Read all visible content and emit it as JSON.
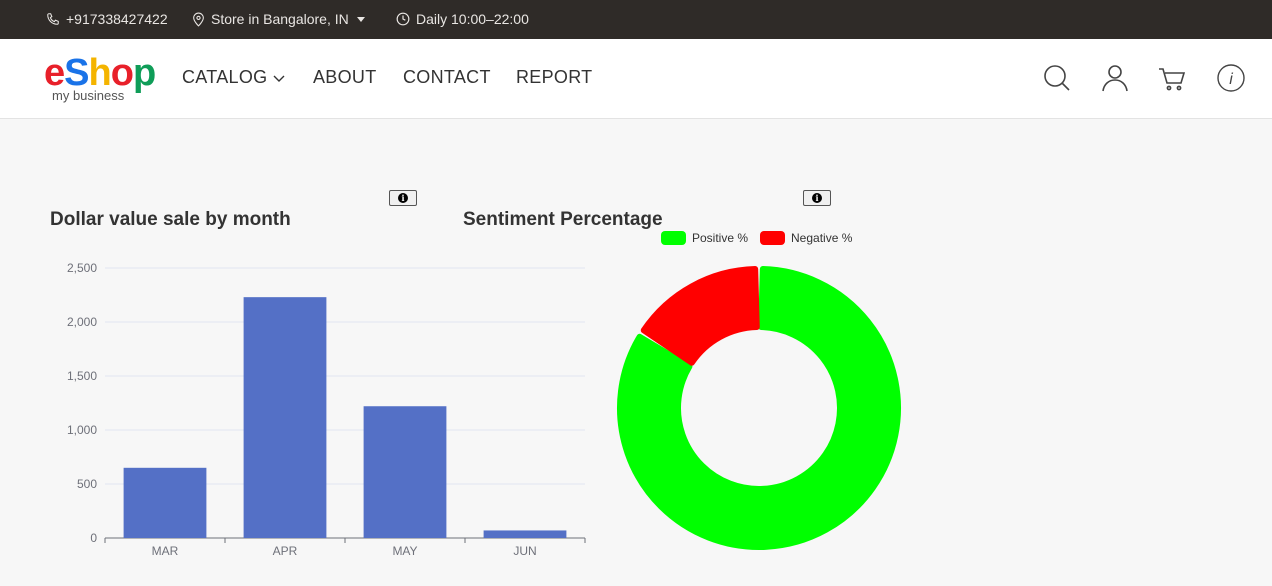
{
  "topbar": {
    "phone": "+917338427422",
    "store": "Store in Bangalore, IN",
    "hours": "Daily 10:00–22:00"
  },
  "header": {
    "logo": {
      "letters": [
        "e",
        "S",
        "h",
        "o",
        "p"
      ],
      "subtitle": "my business"
    },
    "nav": {
      "catalog": "CATALOG",
      "about": "ABOUT",
      "contact": "CONTACT",
      "report": "REPORT"
    },
    "icons": [
      "search-icon",
      "user-icon",
      "cart-icon",
      "info-icon"
    ]
  },
  "colors": {
    "topbar_bg": "#2f2b28",
    "bar": "#5470c6",
    "positive": "#00ff00",
    "negative": "#ff0000",
    "logo": [
      "#e8202a",
      "#1a73e8",
      "#f4b400",
      "#e8202a",
      "#0f9d58"
    ]
  },
  "charts": {
    "sales_title": "Dollar value sale by month",
    "sentiment_title": "Sentiment Percentage",
    "legend": {
      "positive": "Positive %",
      "negative": "Negative %"
    }
  },
  "chart_data": [
    {
      "type": "bar",
      "title": "Dollar value sale by month",
      "categories": [
        "MAR",
        "APR",
        "MAY",
        "JUN"
      ],
      "values": [
        650,
        2230,
        1220,
        70
      ],
      "yticks": [
        "0",
        "500",
        "1,000",
        "1,500",
        "2,000",
        "2,500"
      ],
      "ylim": [
        0,
        2500
      ],
      "grid": true
    },
    {
      "type": "pie",
      "title": "Sentiment Percentage",
      "donut": true,
      "series": [
        {
          "name": "Positive %",
          "value": 84
        },
        {
          "name": "Negative %",
          "value": 16
        }
      ],
      "legend": "top"
    }
  ]
}
